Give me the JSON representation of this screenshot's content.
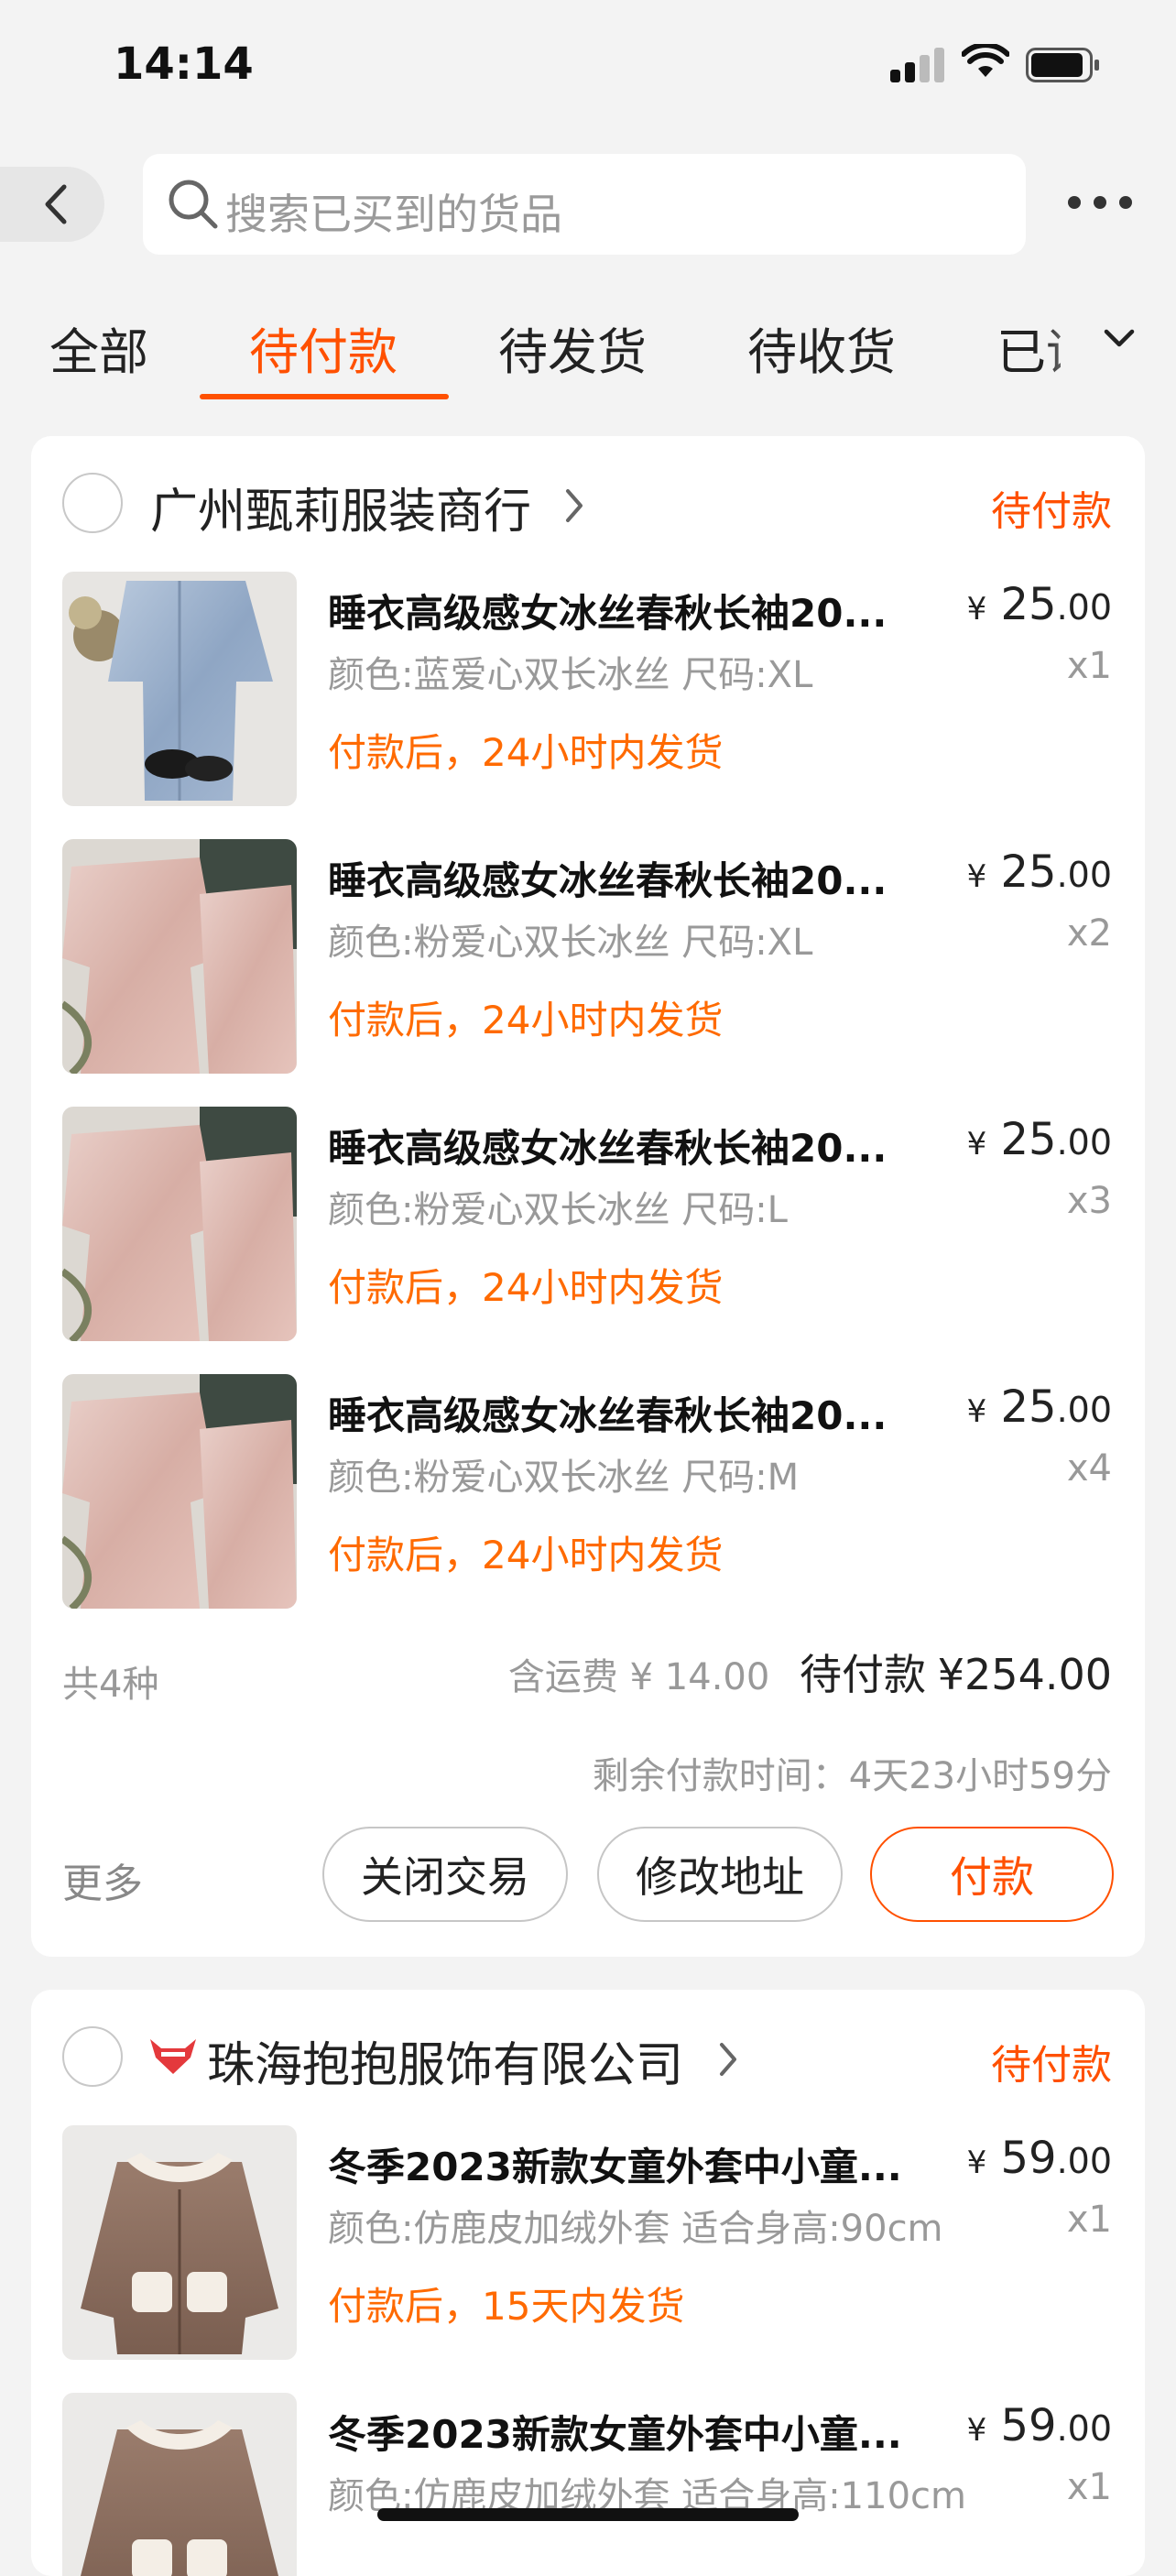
{
  "status_bar": {
    "time": "14:14"
  },
  "search": {
    "placeholder": "搜索已买到的货品"
  },
  "tabs": [
    {
      "label": "全部"
    },
    {
      "label": "待付款",
      "active": true
    },
    {
      "label": "待发货"
    },
    {
      "label": "待收货"
    },
    {
      "label": "已评价"
    }
  ],
  "colors": {
    "accent": "#ff5000",
    "promise": "#ff6a00",
    "muted": "#999999"
  },
  "orders": [
    {
      "shop": "广州甄莉服装商行",
      "status": "待付款",
      "items": [
        {
          "title": "睡衣高级感女冰丝春秋长袖20...",
          "sku": "颜色:蓝爱心双长冰丝 尺码:XL",
          "promise": "付款后，24小时内发货",
          "currency": "¥",
          "price_int": "25",
          "price_dec": ".00",
          "qty": "x1",
          "thumb": "blue-satin-pajamas"
        },
        {
          "title": "睡衣高级感女冰丝春秋长袖20...",
          "sku": "颜色:粉爱心双长冰丝 尺码:XL",
          "promise": "付款后，24小时内发货",
          "currency": "¥",
          "price_int": "25",
          "price_dec": ".00",
          "qty": "x2",
          "thumb": "pink-satin-pajamas"
        },
        {
          "title": "睡衣高级感女冰丝春秋长袖20...",
          "sku": "颜色:粉爱心双长冰丝 尺码:L",
          "promise": "付款后，24小时内发货",
          "currency": "¥",
          "price_int": "25",
          "price_dec": ".00",
          "qty": "x3",
          "thumb": "pink-satin-pajamas"
        },
        {
          "title": "睡衣高级感女冰丝春秋长袖20...",
          "sku": "颜色:粉爱心双长冰丝 尺码:M",
          "promise": "付款后，24小时内发货",
          "currency": "¥",
          "price_int": "25",
          "price_dec": ".00",
          "qty": "x4",
          "thumb": "pink-satin-pajamas"
        }
      ],
      "summary": {
        "count": "共4种",
        "shipping": "含运费 ¥ 14.00",
        "total_label": "待付款",
        "total_currency": "¥",
        "total_int": "254",
        "total_dec": ".00",
        "remaining": "剩余付款时间：4天23小时59分"
      },
      "actions": {
        "more": "更多",
        "close": "关闭交易",
        "modify": "修改地址",
        "pay": "付款"
      }
    },
    {
      "shop": "珠海抱抱服饰有限公司",
      "status": "待付款",
      "items": [
        {
          "title": "冬季2023新款女童外套中小童...",
          "sku": "颜色:仿鹿皮加绒外套 适合身高:90cm",
          "promise": "付款后，15天内发货",
          "currency": "¥",
          "price_int": "59",
          "price_dec": ".00",
          "qty": "x1",
          "thumb": "kids-fleece-coat"
        },
        {
          "title": "冬季2023新款女童外套中小童...",
          "sku": "颜色:仿鹿皮加绒外套 适合身高:110cm",
          "currency": "¥",
          "price_int": "59",
          "price_dec": ".00",
          "qty": "x1",
          "thumb": "kids-fleece-coat"
        }
      ]
    }
  ]
}
